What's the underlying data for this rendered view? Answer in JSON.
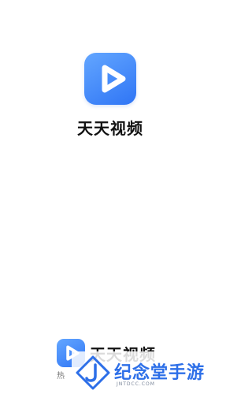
{
  "splash": {
    "app_name": "天天视频",
    "icon": "play-icon",
    "accent_color": "#3f86f7"
  },
  "footer": {
    "app_name": "天天视频",
    "tag": "热",
    "icon": "play-icon"
  },
  "watermark": {
    "title": "纪念堂手游",
    "url": "JNTDCC.COM",
    "logo": "j-logo-icon",
    "color": "#2d6fe8"
  }
}
